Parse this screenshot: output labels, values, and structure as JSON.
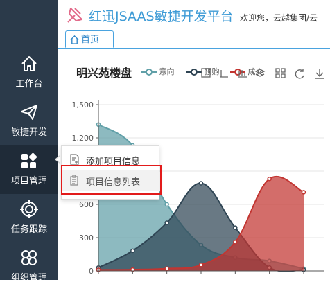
{
  "header": {
    "title": "红迅JSAAS敏捷开发平台",
    "welcome": "欢迎您，云越集团/云"
  },
  "tabs": [
    {
      "label": "首页"
    }
  ],
  "sidebar": {
    "items": [
      {
        "label": "工作台",
        "icon": "home-icon"
      },
      {
        "label": "敏捷开发",
        "icon": "paper-plane-icon"
      },
      {
        "label": "项目管理",
        "icon": "apps-icon"
      },
      {
        "label": "任务跟踪",
        "icon": "target-icon"
      },
      {
        "label": "组织管理",
        "icon": "org-icon"
      }
    ]
  },
  "popup_menu": {
    "items": [
      {
        "label": "添加项目信息",
        "icon": "add-doc-icon"
      },
      {
        "label": "项目信息列表",
        "icon": "clipboard-icon"
      }
    ]
  },
  "chart_data": {
    "type": "area",
    "title": "明兴苑楼盘",
    "categories": [
      "",
      "",
      "",
      "",
      "",
      "",
      ""
    ],
    "series": [
      {
        "name": "意向",
        "color": "#61a0a8",
        "values": [
          1320,
          1132,
          601,
          234,
          120,
          90,
          20
        ]
      },
      {
        "name": "预购",
        "color": "#2f4554",
        "values": [
          30,
          182,
          434,
          791,
          390,
          30,
          10
        ]
      },
      {
        "name": "成交",
        "color": "#c23531",
        "values": [
          10,
          12,
          21,
          54,
          260,
          830,
          710
        ]
      }
    ],
    "yticks": [
      0,
      300,
      600,
      900,
      1200,
      1500
    ],
    "ytick_labels": [
      "0",
      "300",
      "600",
      "900",
      "1,200",
      "1,500"
    ],
    "ylim": [
      0,
      1500
    ],
    "grid": "horizontal",
    "legend_position": "top"
  }
}
